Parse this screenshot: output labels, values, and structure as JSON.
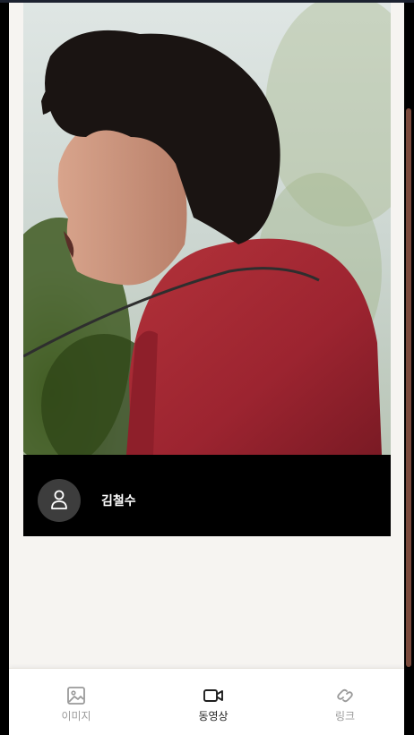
{
  "post": {
    "author_name": "김철수"
  },
  "bottom_nav": {
    "items": [
      {
        "label": "이미지",
        "icon": "image-icon",
        "active": false
      },
      {
        "label": "동영상",
        "icon": "video-camera-icon",
        "active": true
      },
      {
        "label": "링크",
        "icon": "link-icon",
        "active": false
      }
    ]
  },
  "colors": {
    "page_background": "#f6f4f1",
    "card_background": "#000000",
    "avatar_background": "#3d3d3d",
    "nav_active": "#1e1e1e",
    "nav_inactive": "#9a9a9a",
    "scrollbar_thumb": "#7a4a3c"
  }
}
